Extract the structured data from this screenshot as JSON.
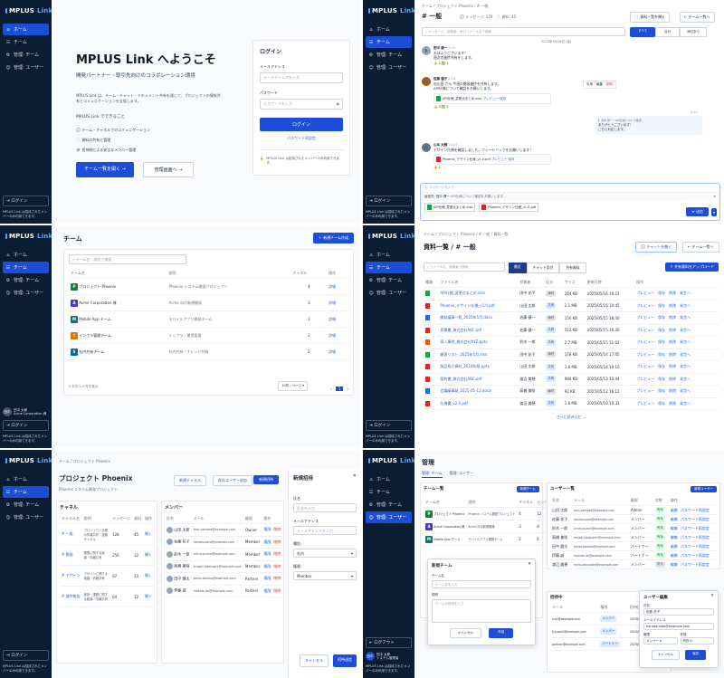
{
  "brand": {
    "name": "MPLUS",
    "suffix": "Link"
  },
  "nav": {
    "home": "ホーム",
    "team": "チーム",
    "manage_team": "管理: チーム",
    "manage_user": "管理: ユーザー"
  },
  "sidebar": {
    "login": "ログイン",
    "logout": "ログアウト",
    "note": "MPLUS Link は招待されたメンバーのみ利用できます。",
    "user_name": "田中 太郎",
    "user_org": "Acme Corporation 様",
    "user_role": "システム管理者",
    "avatar": "田中"
  },
  "welcome": {
    "title": "MPLUS Link へようこそ",
    "subtitle": "開発パートナー・取引先向けのコラボレーション環境",
    "desc": "MPLUS Link は、チーム・チャット・ドキュメント共有を通じて、プロジェクトの情報共有とコミュニケーションを支援します。",
    "features_title": "MPLUS Link でできること",
    "features": [
      "チーム・チャネルでのコミュニケーション",
      "資料の共有と管理",
      "招待制による安全なメンバー管理"
    ],
    "btn_team": "チーム一覧を開く",
    "btn_admin": "管理画面へ"
  },
  "login": {
    "title": "ログイン",
    "email_label": "メールアドレス",
    "email_ph": "メールアドレスを入力",
    "pw_label": "パスワード",
    "pw_ph": "パスワードを入力",
    "submit": "ログイン",
    "forgot": "パスワード再設定",
    "note": "MPLUS Link は招待されたメンバーのみ利用できます。"
  },
  "chat": {
    "breadcrumb": "チーム / プロジェクト Phoenix / # 一般",
    "channel": "# 一般",
    "messages": "メッセージ: 128",
    "files": "資料: 45",
    "btn_files": "資料一覧を開く",
    "btn_back": "チーム一覧へ",
    "search_ph": "メッセージ、投稿者、添付ファイル名で検索",
    "filters": [
      "すべて",
      "自分",
      "添付あり"
    ],
    "date": "2025年5月16日 (金)",
    "msgs": [
      {
        "name": "田中 健一",
        "time": "9:12",
        "text": "おはようございます！\n週次の進捗共有をします。",
        "react": "👍 2 ✅ 1"
      },
      {
        "name": "佐藤 優子",
        "time": "9:18",
        "text": "@山田 さん 今週の開発進捗を共有します。\nAPI仕様について確認をお願いします。",
        "file": "API仕様_変更点まとめ.xlsx",
        "react": "👍 3 ✅ 2"
      },
      {
        "name": "山本 大輔",
        "time": "10:02",
        "text": "デザイン仕様を確認しました。フィードバックをお願いします！",
        "file": "Phoenix_デザイン仕様_v1.0.pdf",
        "react": "👍 1"
      }
    ],
    "self_text": "ありがとうございます！\nこちら対応します。",
    "self_time": "9:42",
    "reply_ph": "メッセージを入力",
    "reply_to": "返信先: 田中 健一",
    "attached": [
      "API仕様_変更点まとめ.xlsx",
      "Phoenix_デザイン仕様_v1.0.pdf"
    ],
    "send": "送信",
    "actions": [
      "引用",
      "編集",
      "削除"
    ]
  },
  "teams": {
    "title": "チーム",
    "create": "新規チーム作成",
    "search_ph": "チーム名・説明で検索",
    "cols": [
      "チーム名",
      "説明",
      "チャネル",
      "操作"
    ],
    "rows": [
      {
        "icon": "P",
        "color": "#15803d",
        "name": "プロジェクト Phoenix",
        "desc": "Phoenix システム開発プロジェクト",
        "ch": "4",
        "act": "詳細"
      },
      {
        "icon": "A",
        "color": "#4338ca",
        "name": "Acme Corporation 様",
        "desc": "Acme 向け新規開発",
        "ch": "3",
        "act": "詳細"
      },
      {
        "icon": "M",
        "color": "#0f766e",
        "name": "Mobile App チーム",
        "desc": "モバイルアプリ開発チーム",
        "ch": "2",
        "act": "詳細"
      },
      {
        "icon": "I",
        "color": "#d97706",
        "name": "インフラ管理チーム",
        "desc": "インフラ・運用管理",
        "ch": "2",
        "act": "詳細"
      },
      {
        "icon": "S",
        "color": "#0369a1",
        "name": "社内共有チーム",
        "desc": "社内共有・ナレッジ共有",
        "ch": "2",
        "act": "詳細"
      }
    ],
    "footer": "5 件中 1-5 件を表示",
    "per_page": "10件 / ページ",
    "page": "1"
  },
  "files": {
    "breadcrumb": "チーム / プロジェクト Phoenix / # 一般 / 資料一覧",
    "title": "資料一覧 / # 一般",
    "btn_chat": "チャットを開く",
    "btn_back": "チーム一覧へ",
    "search_ph": "ファイル名、投稿者で検索",
    "tabs": [
      "最近",
      "チャット添付",
      "共有資料"
    ],
    "upload": "共有資料をアップロード",
    "cols": [
      "種類",
      "ファイル名",
      "投稿者",
      "区分",
      "サイズ",
      "更新日時",
      "操作"
    ],
    "rows": [
      {
        "t": "g",
        "name": "API仕様_変更点まとめ.xlsx",
        "by": "田中 花子",
        "kind": "添付",
        "size": "284 KB",
        "date": "2025/05/16 14:22"
      },
      {
        "t": "r",
        "name": "Phoenix_デザイン仕様_v1.0.pdf",
        "by": "山田 太郎",
        "kind": "共有",
        "size": "2.1 MB",
        "date": "2025/05/16 10:45"
      },
      {
        "t": "b",
        "name": "開発議事一覧_2025年5月.docx",
        "by": "佐藤 健一",
        "kind": "添付",
        "size": "156 KB",
        "date": "2025/05/15 18:30"
      },
      {
        "t": "r",
        "name": "見積書_株式会社ABC.pdf",
        "by": "佐藤 健一",
        "kind": "共有",
        "size": "512 KB",
        "date": "2025/05/15 16:30"
      },
      {
        "t": "o",
        "name": "導入事例_株式会社XYZ.pptx",
        "by": "鈴木 一郎",
        "kind": "共有",
        "size": "2.7 MB",
        "date": "2025/05/15 11:02"
      },
      {
        "t": "g",
        "name": "顧客リスト_2025年5月.xlsx",
        "by": "田中 花子",
        "kind": "添付",
        "size": "178 KB",
        "date": "2025/05/14 17:05"
      },
      {
        "t": "r",
        "name": "製品紹介資料_2024年版.pptx",
        "by": "山田 太郎",
        "kind": "共有",
        "size": "3.8 MB",
        "date": "2025/05/14 10:10"
      },
      {
        "t": "r",
        "name": "契約書_株式会社ABC.pdf",
        "by": "渡辺 美穂",
        "kind": "共有",
        "size": "986 KB",
        "date": "2025/05/13 13:44"
      },
      {
        "t": "b",
        "name": "会議議事録_2025-05-12.docx",
        "by": "高橋 美咲",
        "kind": "添付",
        "size": "92 KB",
        "date": "2025/05/12 16:12"
      },
      {
        "t": "r",
        "name": "仕様書_v2.0.pdf",
        "by": "渡辺 美穂",
        "kind": "共有",
        "size": "1.6 MB",
        "date": "2025/05/10 10:33"
      }
    ],
    "actions": [
      "プレビュー",
      "保存",
      "削除",
      "発言へ"
    ],
    "more": "さらに読み込む"
  },
  "project": {
    "breadcrumb": "チーム / プロジェクト Phoenix",
    "title": "プロジェクト Phoenix",
    "subtitle": "Phoenix システム開発プロジェクト",
    "btn_channel": "新規チャネル",
    "btn_add": "既存ユーザー追加",
    "btn_invite": "新規招待",
    "ch_title": "チャネル",
    "ch_cols": [
      "チャネル名",
      "説明",
      "メッセージ",
      "資料",
      "操作"
    ],
    "channels": [
      {
        "name": "# 一般",
        "desc": "プロジェクト全般の情報共有・連絡チャネル",
        "msg": "128",
        "doc": "45",
        "act": "開く"
      },
      {
        "name": "# 開発",
        "desc": "開発に関する議論・情報共有",
        "msg": "256",
        "doc": "32",
        "act": "開く"
      },
      {
        "name": "# デザイン",
        "desc": "デザインに関する議論・情報共有",
        "msg": "97",
        "doc": "23",
        "act": "開く"
      },
      {
        "name": "# 進捗報告",
        "desc": "進捗・課題に関する議論・情報共有",
        "msg": "64",
        "doc": "12",
        "act": "開く"
      }
    ],
    "mem_title": "メンバー",
    "mem_cols": [
      "氏名",
      "メール",
      "権限",
      "操作"
    ],
    "members": [
      {
        "name": "山田 太郎",
        "mail": "taro.yamada@example.com",
        "role": "Owner"
      },
      {
        "name": "佐藤 花子",
        "mail": "hanako.sato@example.com",
        "role": "Member"
      },
      {
        "name": "鈴木 一郎",
        "mail": "ichiro.suzuki@example.com",
        "role": "Member"
      },
      {
        "name": "高橋 美咲",
        "mail": "misaki.takahashi@example.com",
        "role": "Member"
      },
      {
        "name": "田中 健太",
        "mail": "kenta.tanaka@example.com",
        "role": "Partner"
      },
      {
        "name": "伊藤 誠",
        "mail": "makoto.ito@example.com",
        "role": "Partner"
      }
    ],
    "mem_actions": [
      "権限",
      "削除"
    ],
    "invite": {
      "title": "新規招待",
      "name_label": "氏名",
      "name_ph": "氏名を入力",
      "email_label": "メールアドレス",
      "email_ph": "メールアドレスを入力",
      "kind_label": "種別",
      "kind_val": "社内",
      "role_label": "権限",
      "role_val": "Member",
      "cancel": "キャンセル",
      "submit": "招待送信"
    }
  },
  "admin": {
    "title": "管理",
    "tabs": [
      "管理: チーム",
      "管理: ユーザー"
    ],
    "team_title": "チーム一覧",
    "team_create": "新規チーム",
    "team_cols": [
      "チーム名",
      "説明",
      "チャネル",
      "メンバー",
      "操作"
    ],
    "team_rows": [
      {
        "icon": "P",
        "color": "#15803d",
        "name": "プロジェクト Phoenix",
        "desc": "Phoenix システム開発プロジェクト",
        "ch": "4",
        "mem": "12",
        "act": "編集"
      },
      {
        "icon": "A",
        "color": "#4338ca",
        "name": "Acme Corporation 様",
        "desc": "Acme 向け新規開発",
        "ch": "3",
        "mem": "8",
        "act": "編集"
      },
      {
        "icon": "M",
        "color": "#0f766e",
        "name": "Mobile App チーム",
        "desc": "モバイルアプリ開発チーム",
        "ch": "2",
        "mem": "6",
        "act": "編集"
      }
    ],
    "new_team": {
      "title": "新規チーム",
      "name_label": "チーム名",
      "name_ph": "チーム名を入力",
      "desc_label": "説明",
      "desc_ph": "チームの説明を入力",
      "cancel": "キャンセル",
      "submit": "作成"
    },
    "user_title": "ユーザー一覧",
    "user_create": "新規ユーザー",
    "user_cols": [
      "氏名",
      "メール",
      "権限",
      "状態",
      "操作"
    ],
    "users": [
      {
        "name": "山田 太郎",
        "mail": "taro.yamada@example.com",
        "role": "Admin",
        "status": "有効"
      },
      {
        "name": "佐藤 花子",
        "mail": "hanako.sato@example.com",
        "role": "メンバー",
        "status": "有効"
      },
      {
        "name": "鈴木 一郎",
        "mail": "ichiro.suzuki@example.com",
        "role": "メンバー",
        "status": "有効"
      },
      {
        "name": "高橋 美咲",
        "mail": "misaki.takahashi@example.com",
        "role": "メンバー",
        "status": "有効"
      },
      {
        "name": "田中 健太",
        "mail": "kenta.tanaka@example.com",
        "role": "パートナー",
        "status": "有効"
      },
      {
        "name": "伊藤 誠",
        "mail": "makoto.ito@example.com",
        "role": "パートナー",
        "status": "有効"
      },
      {
        "name": "渡辺 美穂",
        "mail": "miho.watanabe@example.com",
        "role": "メンバー",
        "status": "無効"
      }
    ],
    "user_actions": [
      "編集",
      "パスワード再設定"
    ],
    "invite_title": "招待中",
    "invite_cols": [
      "メール",
      "権限",
      "招待日",
      "操作"
    ],
    "invites": [
      {
        "mail": "yuki@example.com",
        "role": "メンバー",
        "date": "2025/05/16",
        "act": "取消"
      },
      {
        "mail": "k.suzuki@example.com",
        "role": "メンバー",
        "date": "2025/05/15",
        "act": "取消"
      },
      {
        "mail": "partner@example.com",
        "role": "パートナー",
        "date": "2025/05/14",
        "act": "取消"
      }
    ],
    "edit_user": {
      "title": "ユーザー編集",
      "name_label": "氏名",
      "name_val": "佐藤 花子",
      "email_label": "メールアドレス",
      "email_val": "hanako.sato@example.com",
      "role_label": "権限",
      "role_val": "メンバー",
      "status_label": "状態",
      "status_val": "有効",
      "cancel": "キャンセル",
      "submit": "保存"
    }
  }
}
